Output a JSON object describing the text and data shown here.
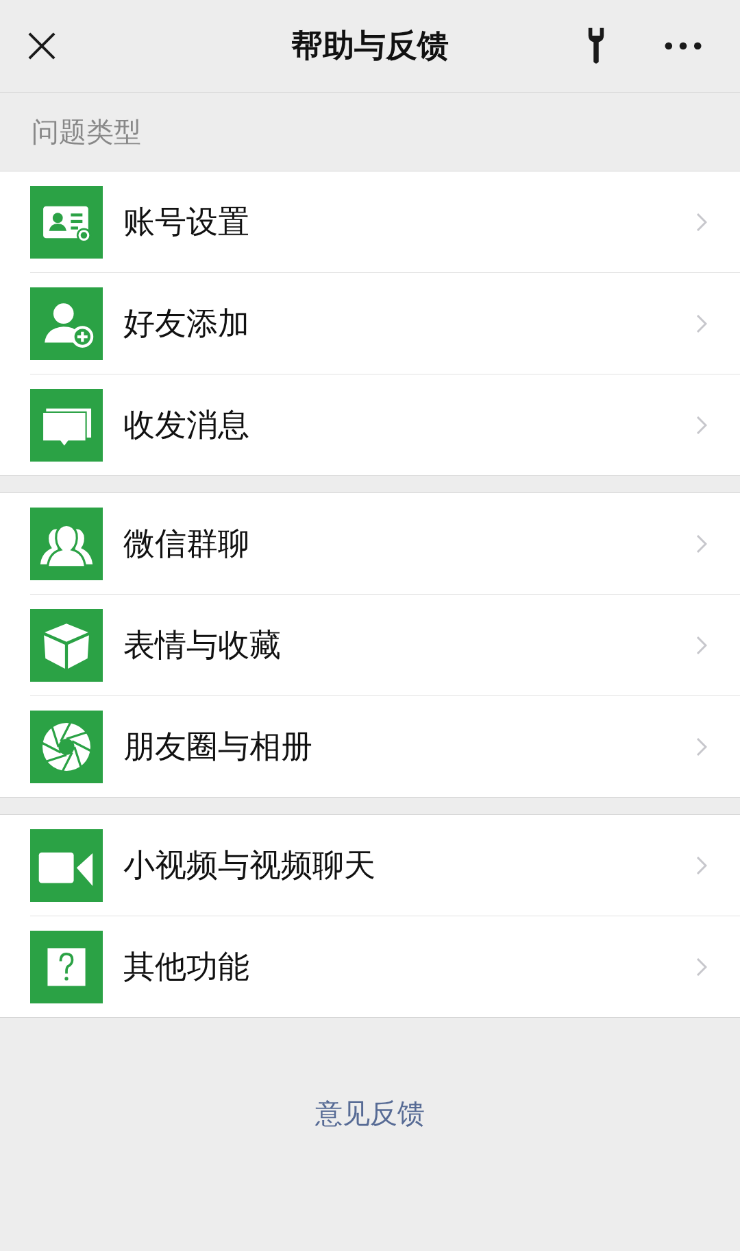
{
  "header": {
    "title": "帮助与反馈"
  },
  "section_label": "问题类型",
  "groups": [
    {
      "items": [
        {
          "label": "账号设置",
          "kind": "account"
        },
        {
          "label": "好友添加",
          "kind": "friend"
        },
        {
          "label": "收发消息",
          "kind": "message"
        }
      ]
    },
    {
      "items": [
        {
          "label": "微信群聊",
          "kind": "group"
        },
        {
          "label": "表情与收藏",
          "kind": "sticker"
        },
        {
          "label": "朋友圈与相册",
          "kind": "moments"
        }
      ]
    },
    {
      "items": [
        {
          "label": "小视频与视频聊天",
          "kind": "video"
        },
        {
          "label": "其他功能",
          "kind": "other"
        }
      ]
    }
  ],
  "footer_link": "意见反馈"
}
